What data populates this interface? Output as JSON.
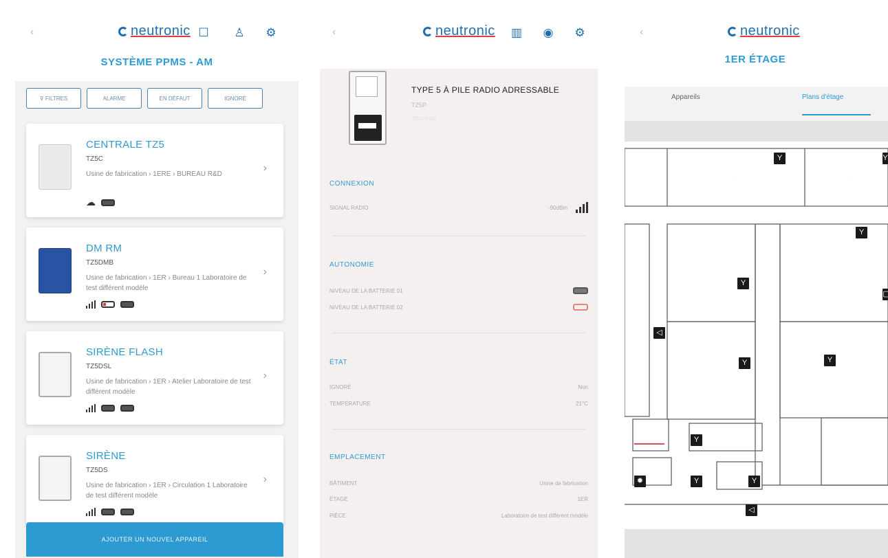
{
  "brand": {
    "logo_text": "neutronic",
    "accent": "#2d9bd2",
    "logo_blue": "#1f6fb0",
    "logo_red": "#e0393e"
  },
  "screen1": {
    "title": "SYSTÈME PPMS - AM",
    "icons": [
      "calendar-icon",
      "users-icon",
      "settings-icon"
    ],
    "filters": [
      "FILTRES",
      "ALARME",
      "EN DÉFAUT",
      "IGNORÉ"
    ],
    "cards": [
      {
        "title": "CENTRALE TZ5",
        "code": "TZ5C",
        "location": "Usine de fabrication › 1ERE › BUREAU R&D",
        "status_icons": [
          "cloud",
          "battery-full"
        ]
      },
      {
        "title": "DM RM",
        "code": "TZ5DMB",
        "location": "Usine de fabrication › 1ER › Bureau 1 Laboratoire de test différent modèle",
        "status_icons": [
          "signal",
          "battery-low",
          "battery-full"
        ]
      },
      {
        "title": "SIRÈNE FLASH",
        "code": "TZ5DSL",
        "location": "Usine de fabrication › 1ER › Atelier Laboratoire de test différent modèle",
        "status_icons": [
          "signal",
          "battery-full",
          "battery-full"
        ]
      },
      {
        "title": "SIRÈNE",
        "code": "TZ5DS",
        "location": "Usine de fabrication › 1ER › Circulation 1 Laboratoire de test différent modèle",
        "status_icons": [
          "signal",
          "battery-full",
          "battery-full"
        ]
      }
    ],
    "add_button": "AJOUTER UN NOUVEL APPAREIL"
  },
  "screen2": {
    "icons": [
      "map-icon",
      "location-icon",
      "settings-icon"
    ],
    "device_title": "TYPE 5 À PILE RADIO ADRESSABLE",
    "device_code": "TZ5P",
    "device_sub": "TZ5C-0023",
    "sections": {
      "connexion": {
        "heading": "CONNEXION",
        "rows": [
          {
            "label": "SIGNAL RADIO",
            "value": "-90dBm"
          }
        ]
      },
      "autonomie": {
        "heading": "AUTONOMIE",
        "rows": [
          {
            "label": "NIVEAU DE LA BATTERIE 01"
          },
          {
            "label": "NIVEAU DE LA BATTERIE 02"
          }
        ]
      },
      "etat": {
        "heading": "ÉTAT",
        "rows": [
          {
            "label": "IGNORÉ",
            "value": "Non"
          },
          {
            "label": "TEMPÉRATURE",
            "value": "21°C"
          }
        ]
      },
      "emplacement": {
        "heading": "EMPLACEMENT",
        "rows": [
          {
            "label": "BÂTIMENT",
            "value": "Usine de fabrication"
          },
          {
            "label": "ÉTAGE",
            "value": "1ER"
          },
          {
            "label": "PIÈCE",
            "value": "Laboratoire de test différent modèle"
          }
        ]
      }
    }
  },
  "screen3": {
    "title": "1ER ÉTAGE",
    "tabs": [
      "Appareils",
      "Plans d'étage"
    ],
    "active_tab": 1
  }
}
